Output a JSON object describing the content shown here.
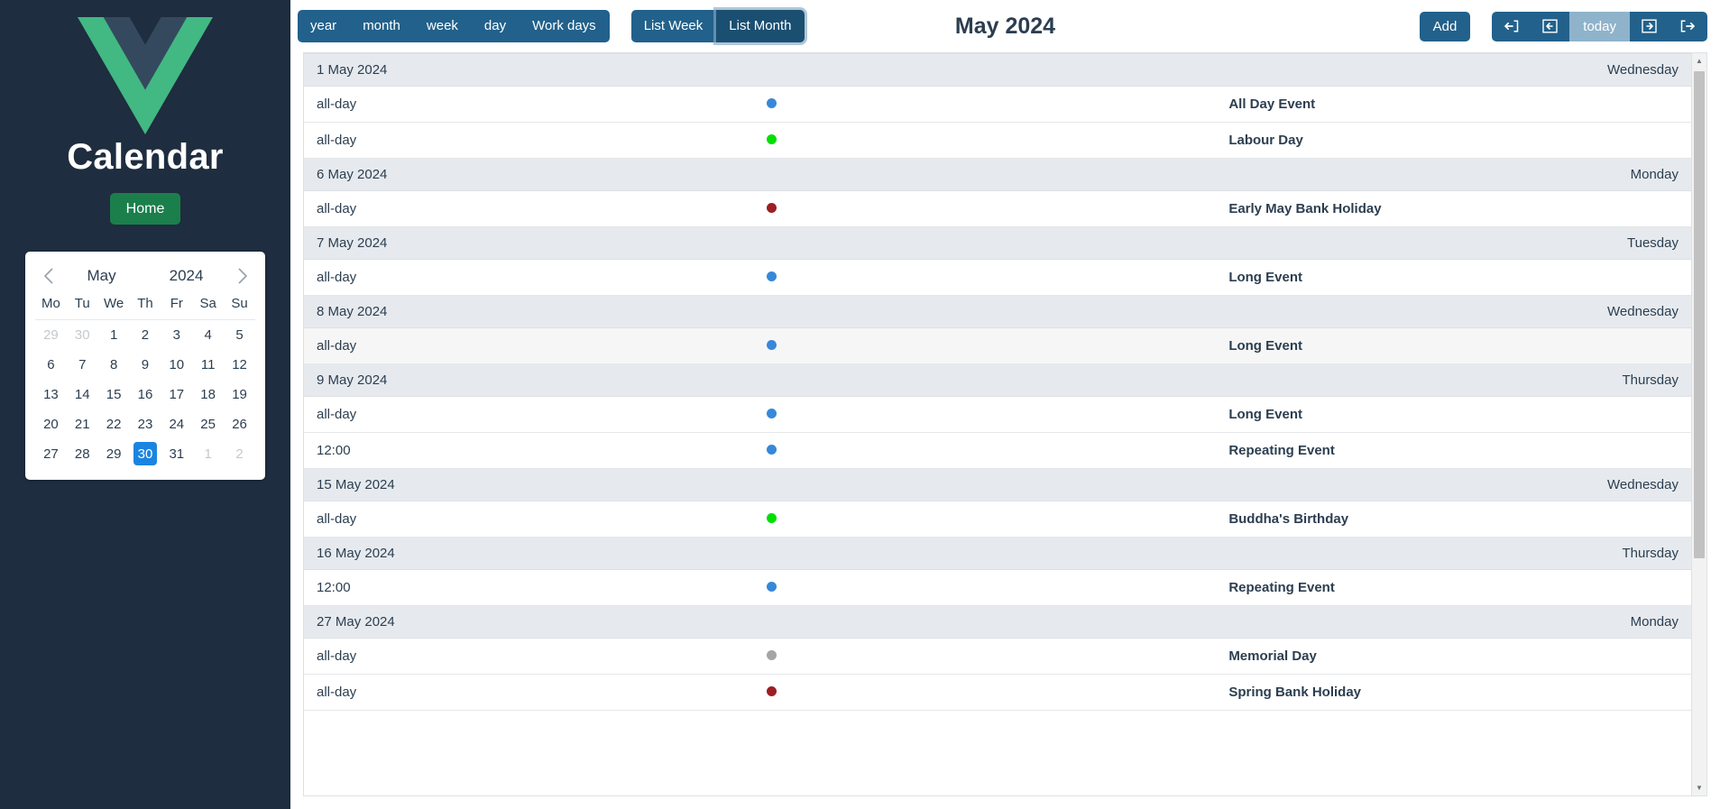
{
  "sidebar": {
    "logo_icon": "vue-logo-icon",
    "title": "Calendar",
    "home_label": "Home",
    "minical": {
      "prev_icon": "chevron-left-icon",
      "next_icon": "chevron-right-icon",
      "month": "May",
      "year": "2024",
      "weekdays": [
        "Mo",
        "Tu",
        "We",
        "Th",
        "Fr",
        "Sa",
        "Su"
      ],
      "weeks": [
        [
          {
            "d": "29",
            "muted": true
          },
          {
            "d": "30",
            "muted": true
          },
          {
            "d": "1"
          },
          {
            "d": "2"
          },
          {
            "d": "3"
          },
          {
            "d": "4"
          },
          {
            "d": "5"
          }
        ],
        [
          {
            "d": "6"
          },
          {
            "d": "7"
          },
          {
            "d": "8"
          },
          {
            "d": "9"
          },
          {
            "d": "10"
          },
          {
            "d": "11"
          },
          {
            "d": "12"
          }
        ],
        [
          {
            "d": "13"
          },
          {
            "d": "14"
          },
          {
            "d": "15"
          },
          {
            "d": "16"
          },
          {
            "d": "17"
          },
          {
            "d": "18"
          },
          {
            "d": "19"
          }
        ],
        [
          {
            "d": "20"
          },
          {
            "d": "21"
          },
          {
            "d": "22"
          },
          {
            "d": "23"
          },
          {
            "d": "24"
          },
          {
            "d": "25"
          },
          {
            "d": "26"
          }
        ],
        [
          {
            "d": "27"
          },
          {
            "d": "28"
          },
          {
            "d": "29"
          },
          {
            "d": "30",
            "selected": true
          },
          {
            "d": "31"
          },
          {
            "d": "1",
            "muted": true
          },
          {
            "d": "2",
            "muted": true
          }
        ]
      ],
      "selected_day": "30"
    }
  },
  "toolbar": {
    "view_buttons": [
      {
        "label": "year",
        "active": false
      },
      {
        "label": "month",
        "active": false
      },
      {
        "label": "week",
        "active": false
      },
      {
        "label": "day",
        "active": false
      },
      {
        "label": "Work days",
        "active": false
      }
    ],
    "list_buttons": [
      {
        "label": "List Week",
        "active": false
      },
      {
        "label": "List Month",
        "active": true
      }
    ],
    "title": "May 2024",
    "add_label": "Add",
    "nav_buttons": [
      {
        "icon": "prev-year-icon",
        "label": "",
        "style": "dark"
      },
      {
        "icon": "prev-month-icon",
        "label": "",
        "style": "dark"
      },
      {
        "icon": "",
        "label": "today",
        "style": "light"
      },
      {
        "icon": "next-month-icon",
        "label": "",
        "style": "dark"
      },
      {
        "icon": "next-year-icon",
        "label": "",
        "style": "dark"
      }
    ]
  },
  "colors": {
    "sidebar_bg": "#1e2d3f",
    "brand_green": "#42b883",
    "home_btn": "#1b7f4b",
    "toolbar_btn": "#22618b",
    "toolbar_btn_active": "#1b4f71",
    "toolbar_btn_light": "#8fb3cb",
    "selected_day": "#1a85e0",
    "event_blue": "#3788d8",
    "event_green": "#00e000",
    "event_red": "#9c1f23",
    "event_grey": "#a5a5a5",
    "day_header_bg": "#e6eaee"
  },
  "list": {
    "days": [
      {
        "date": "1 May 2024",
        "weekday": "Wednesday",
        "events": [
          {
            "time": "all-day",
            "dot": "#3788d8",
            "title": "All Day Event",
            "hovered": false
          },
          {
            "time": "all-day",
            "dot": "#00e000",
            "title": "Labour Day",
            "hovered": false
          }
        ]
      },
      {
        "date": "6 May 2024",
        "weekday": "Monday",
        "events": [
          {
            "time": "all-day",
            "dot": "#9c1f23",
            "title": "Early May Bank Holiday",
            "hovered": false
          }
        ]
      },
      {
        "date": "7 May 2024",
        "weekday": "Tuesday",
        "events": [
          {
            "time": "all-day",
            "dot": "#3788d8",
            "title": "Long Event",
            "hovered": false
          }
        ]
      },
      {
        "date": "8 May 2024",
        "weekday": "Wednesday",
        "events": [
          {
            "time": "all-day",
            "dot": "#3788d8",
            "title": "Long Event",
            "hovered": true
          }
        ]
      },
      {
        "date": "9 May 2024",
        "weekday": "Thursday",
        "events": [
          {
            "time": "all-day",
            "dot": "#3788d8",
            "title": "Long Event",
            "hovered": false
          },
          {
            "time": "12:00",
            "dot": "#3788d8",
            "title": "Repeating Event",
            "hovered": false
          }
        ]
      },
      {
        "date": "15 May 2024",
        "weekday": "Wednesday",
        "events": [
          {
            "time": "all-day",
            "dot": "#00e000",
            "title": "Buddha's Birthday",
            "hovered": false
          }
        ]
      },
      {
        "date": "16 May 2024",
        "weekday": "Thursday",
        "events": [
          {
            "time": "12:00",
            "dot": "#3788d8",
            "title": "Repeating Event",
            "hovered": false
          }
        ]
      },
      {
        "date": "27 May 2024",
        "weekday": "Monday",
        "events": [
          {
            "time": "all-day",
            "dot": "#a5a5a5",
            "title": "Memorial Day",
            "hovered": false
          },
          {
            "time": "all-day",
            "dot": "#9c1f23",
            "title": "Spring Bank Holiday",
            "hovered": false
          }
        ]
      }
    ],
    "scrollbar": {
      "up_icon": "scroll-up-icon",
      "down_icon": "scroll-down-icon"
    }
  }
}
